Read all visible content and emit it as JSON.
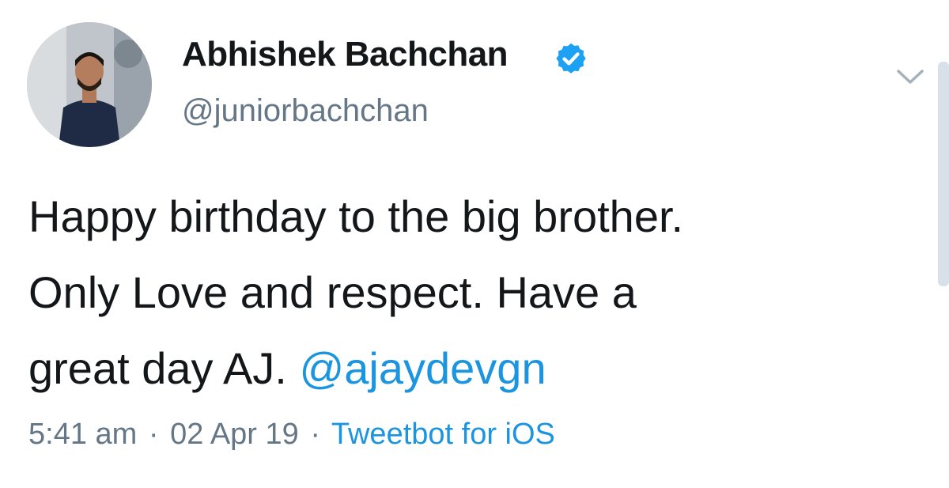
{
  "author": {
    "name": "Abhishek Bachchan",
    "handle": "@juniorbachchan",
    "verified": true
  },
  "tweet": {
    "lines": [
      "Happy birthday to the big brother.",
      "Only Love and respect. Have a",
      "great day AJ. "
    ],
    "mention": "@ajaydevgn"
  },
  "meta": {
    "time": "5:41 am",
    "separator": "·",
    "date": "02 Apr 19",
    "source": "Tweetbot for iOS"
  },
  "colors": {
    "link": "#1b95e0",
    "secondary_text": "#657786",
    "verified_badge": "#1da1f2"
  },
  "icons": {
    "verified": "verified-badge-icon",
    "menu": "chevron-down-icon"
  }
}
